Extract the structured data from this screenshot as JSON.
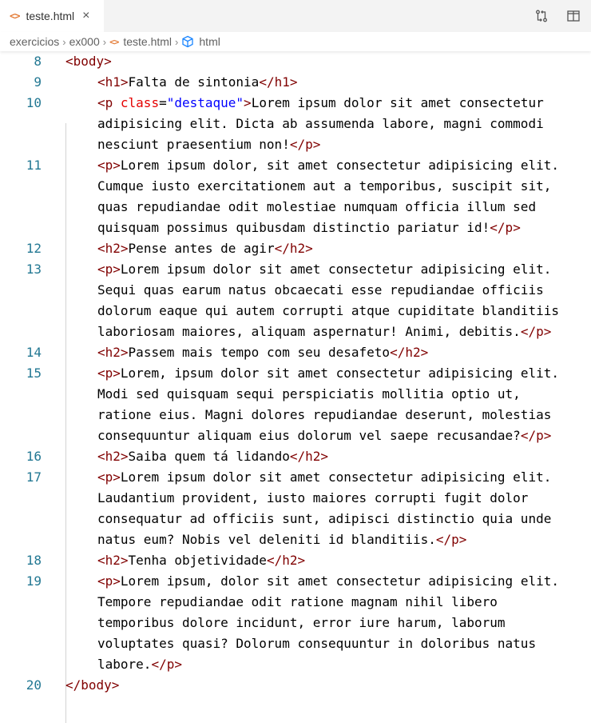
{
  "tab": {
    "label": "teste.html",
    "icon": "html-file-icon",
    "close_glyph": "×"
  },
  "breadcrumb": [
    "exercicios",
    "ex000",
    "teste.html",
    "html"
  ],
  "lines": [
    {
      "n": "8",
      "code": "<body>"
    },
    {
      "n": "9",
      "code": "<h1>Falta de sintonia</h1>"
    },
    {
      "n": "10",
      "code": "<p class=\"destaque\">Lorem ipsum dolor sit amet consectetur"
    },
    {
      "n": "",
      "code": "adipisicing elit. Dicta ab assumenda labore, magni commodi"
    },
    {
      "n": "",
      "code": "nesciunt praesentium non!</p>"
    },
    {
      "n": "11",
      "code": "<p>Lorem ipsum dolor, sit amet consectetur adipisicing elit."
    },
    {
      "n": "",
      "code": "Cumque iusto exercitationem aut a temporibus, suscipit sit,"
    },
    {
      "n": "",
      "code": "quas repudiandae odit molestiae numquam officia illum sed"
    },
    {
      "n": "",
      "code": "quisquam possimus quibusdam distinctio pariatur id!</p>"
    },
    {
      "n": "12",
      "code": "<h2>Pense antes de agir</h2>"
    },
    {
      "n": "13",
      "code": "<p>Lorem ipsum dolor sit amet consectetur adipisicing elit."
    },
    {
      "n": "",
      "code": "Sequi quas earum natus obcaecati esse repudiandae officiis"
    },
    {
      "n": "",
      "code": "dolorum eaque qui autem corrupti atque cupiditate blanditiis"
    },
    {
      "n": "",
      "code": "laboriosam maiores, aliquam aspernatur! Animi, debitis.</p>"
    },
    {
      "n": "14",
      "code": "<h2>Passem mais tempo com seu desafeto</h2>"
    },
    {
      "n": "15",
      "code": "<p>Lorem, ipsum dolor sit amet consectetur adipisicing elit."
    },
    {
      "n": "",
      "code": "Modi sed quisquam sequi perspiciatis mollitia optio ut,"
    },
    {
      "n": "",
      "code": "ratione eius. Magni dolores repudiandae deserunt, molestias"
    },
    {
      "n": "",
      "code": "consequuntur aliquam eius dolorum vel saepe recusandae?</p>"
    },
    {
      "n": "16",
      "code": "<h2>Saiba quem tá lidando</h2>"
    },
    {
      "n": "17",
      "code": "<p>Lorem ipsum dolor sit amet consectetur adipisicing elit."
    },
    {
      "n": "",
      "code": "Laudantium provident, iusto maiores corrupti fugit dolor"
    },
    {
      "n": "",
      "code": "consequatur ad officiis sunt, adipisci distinctio quia unde"
    },
    {
      "n": "",
      "code": "natus eum? Nobis vel deleniti id blanditiis.</p>"
    },
    {
      "n": "18",
      "code": "<h2>Tenha objetividade</h2>"
    },
    {
      "n": "19",
      "code": "<p>Lorem ipsum, dolor sit amet consectetur adipisicing elit."
    },
    {
      "n": "",
      "code": "Tempore repudiandae odit ratione magnam nihil libero"
    },
    {
      "n": "",
      "code": "temporibus dolore incidunt, error iure harum, laborum"
    },
    {
      "n": "",
      "code": "voluptates quasi? Dolorum consequuntur in doloribus natus"
    },
    {
      "n": "",
      "code": "labore.</p>"
    },
    {
      "n": "20",
      "code": "</body>"
    }
  ],
  "colors": {
    "tag": "#800000",
    "attr": "#e50000",
    "string": "#0000ff",
    "line_number": "#237893",
    "file_icon": "#e37933"
  },
  "icons": [
    "html-file-icon",
    "close-icon",
    "source-control-compare-icon",
    "split-editor-icon",
    "chevron-right-icon",
    "symbol-cube-icon"
  ]
}
